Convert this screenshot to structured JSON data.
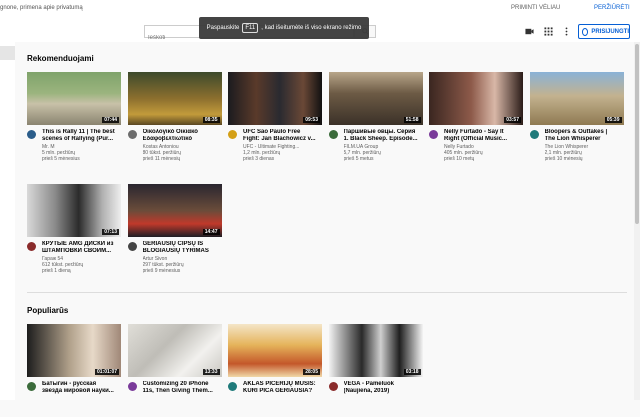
{
  "notice": {
    "text": "gnone, primena apie privatumą",
    "remind_label": "PRIMINTI VĖLIAU",
    "review_label": "PERŽIŪRĖTI"
  },
  "header": {
    "search_placeholder": "Ieškoti",
    "signin_label": "PRISIJUNGTI"
  },
  "fullscreen_toast": {
    "before": "Paspauskite",
    "key": "F11",
    "after": ", kad išeitumėte iš viso ekrano režimo"
  },
  "recommended": {
    "title": "Rekomenduojami",
    "videos": [
      {
        "line1": "This is Rally 11 | The best",
        "line2": "scenes of Rallying (Pur...",
        "channel": "Mr. M",
        "views": "5 mln. peržiūrų",
        "age": "prieš 5 mėnesius",
        "duration": "07:44"
      },
      {
        "line1": "Οικολογικό Οικιακό",
        "line2": "Εδαφοβελτιωτικό",
        "channel": "Kostas Antoniou",
        "views": "80 tūkst. peržiūrų",
        "age": "prieš 11 mėnesių",
        "duration": "08:35"
      },
      {
        "line1": "UFC São Paulo Free",
        "line2": "Fight: Jan Blachowicz v...",
        "channel": "UFC - Ultimate Fighting...",
        "views": "1,2 mln. peržiūrų",
        "age": "prieš 3 dienas",
        "duration": "09:53"
      },
      {
        "line1": "Паршивые овцы. Серия",
        "line2": "1. Black Sheep. Episode...",
        "channel": "FILM.UA Group",
        "views": "5,7 mln. peržiūrų",
        "age": "prieš 5 metus",
        "duration": "51:58"
      },
      {
        "line1": "Nelly Furtado - Say It",
        "line2": "Right (Official Music...",
        "channel": "Nelly Furtado",
        "views": "405 mln. peržiūrų",
        "age": "prieš 10 metų",
        "duration": "03:57"
      },
      {
        "line1": "Bloopers & Outtakes |",
        "line2": "The Lion Whisperer",
        "channel": "The Lion Whisperer",
        "views": "2,1 mln. peržiūrų",
        "age": "prieš 10 mėnesių",
        "duration": "05:39"
      },
      {
        "line1": "КРУТЫЕ AMG ДИСКИ из",
        "line2": "ШТАМПОВКИ СВОИМ...",
        "channel": "Гараж 54",
        "views": "612 tūkst. peržiūrų",
        "age": "prieš 1 dieną",
        "duration": "07:13"
      },
      {
        "line1": "GERIAUSIŲ ČIPSŲ IŠ",
        "line2": "BLOGIAUSIŲ TYRIMAS",
        "channel": "Artur Sivon",
        "views": "297 tūkst. peržiūrų",
        "age": "prieš 9 mėnesius",
        "duration": "14:47"
      }
    ]
  },
  "popular": {
    "title": "Populiarūs",
    "videos": [
      {
        "line1": "Батыгин - русская",
        "line2": "звезда мировой науки...",
        "duration": "01:01:07"
      },
      {
        "line1": "Customizing 20 iPhone",
        "line2": "11s, Then Giving Them...",
        "duration": "13:33"
      },
      {
        "line1": "AKLAS PICERIJŲ MŪŠIS:",
        "line2": "KURI PICA GERIAUSIA?",
        "duration": "28:05"
      },
      {
        "line1": "VEGA - Pameluok",
        "line2": "(Naujiena, 2019)",
        "duration": "03:18"
      }
    ]
  }
}
